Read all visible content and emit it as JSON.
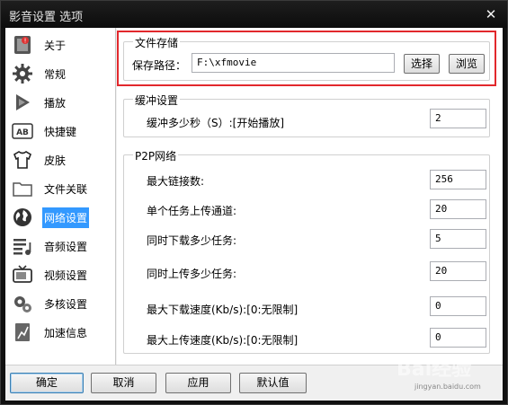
{
  "window": {
    "title": "影音设置 选项",
    "close_glyph": "✕"
  },
  "sidebar": {
    "items": [
      {
        "label": "关于",
        "icon": "about-icon"
      },
      {
        "label": "常规",
        "icon": "gear-icon"
      },
      {
        "label": "播放",
        "icon": "play-icon"
      },
      {
        "label": "快捷键",
        "icon": "keyboard-icon"
      },
      {
        "label": "皮肤",
        "icon": "tshirt-icon"
      },
      {
        "label": "文件关联",
        "icon": "folder-icon"
      },
      {
        "label": "网络设置",
        "icon": "globe-icon",
        "selected": true
      },
      {
        "label": "音频设置",
        "icon": "audio-icon"
      },
      {
        "label": "视频设置",
        "icon": "tv-icon"
      },
      {
        "label": "多核设置",
        "icon": "multicore-icon"
      },
      {
        "label": "加速信息",
        "icon": "speed-info-icon"
      }
    ]
  },
  "storage": {
    "title": "文件存储",
    "path_label": "保存路径：",
    "path_value": "F:\\xfmovie",
    "select_button": "选择",
    "browse_button": "浏览"
  },
  "buffer": {
    "title": "缓冲设置",
    "label": "缓冲多少秒（S）:[开始播放]",
    "value": "2"
  },
  "p2p": {
    "title": "P2P网络",
    "fields": [
      {
        "label": "最大链接数:",
        "value": "256"
      },
      {
        "label": "单个任务上传通道:",
        "value": "20"
      },
      {
        "label": "同时下载多少任务:",
        "value": "5"
      },
      {
        "label": "同时上传多少任务:",
        "value": "20"
      },
      {
        "label": "最大下载速度(Kb/s):[0:无限制]",
        "value": "0"
      },
      {
        "label": "最大上传速度(Kb/s):[0:无限制]",
        "value": "0"
      }
    ]
  },
  "buttons": {
    "ok": "确定",
    "cancel": "取消",
    "apply": "应用",
    "default": "默认值"
  },
  "watermark": {
    "text": "Bai经验",
    "sub": "jingyan.baidu.com"
  },
  "colors": {
    "highlight": "#e2282c",
    "selection": "#3399ff"
  }
}
